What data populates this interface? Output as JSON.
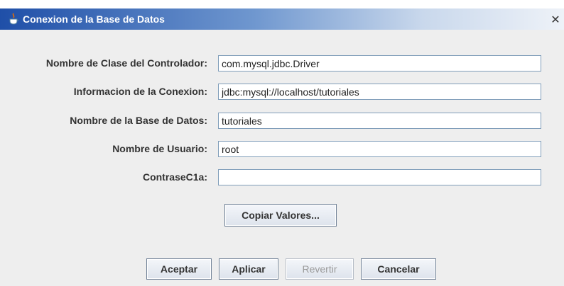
{
  "window": {
    "title": "Conexion de la Base de Datos",
    "icon": "java-cup-icon",
    "close_glyph": "✕"
  },
  "form": {
    "fields": [
      {
        "label": "Nombre de Clase del Controlador:",
        "value": "com.mysql.jdbc.Driver"
      },
      {
        "label": "Informacion de la Conexion:",
        "value": "jdbc:mysql://localhost/tutoriales"
      },
      {
        "label": "Nombre de la Base de Datos:",
        "value": "tutoriales"
      },
      {
        "label": "Nombre de Usuario:",
        "value": "root"
      },
      {
        "label": "ContraseC1a:",
        "value": ""
      }
    ],
    "copy_button": "Copiar Valores..."
  },
  "buttons": {
    "accept": "Aceptar",
    "apply": "Aplicar",
    "revert": "Revertir",
    "cancel": "Cancelar"
  },
  "colors": {
    "title_bar_start": "#1f4fa8",
    "field_border": "#7f9db9",
    "background": "#eeeeee"
  }
}
